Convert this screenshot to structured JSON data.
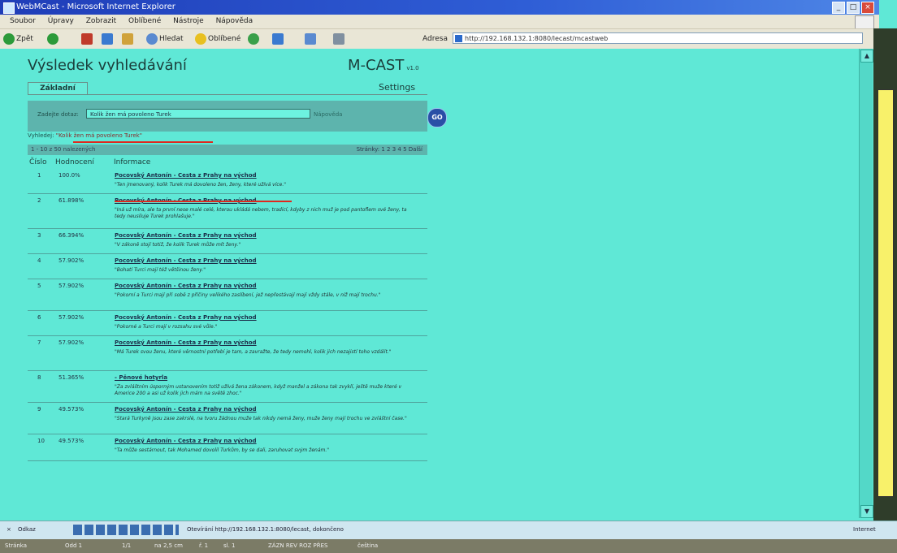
{
  "window": {
    "title": "WebMCast - Microsoft Internet Explorer"
  },
  "menu": {
    "items": [
      "Soubor",
      "Úpravy",
      "Zobrazit",
      "Oblíbené",
      "Nástroje",
      "Nápověda"
    ]
  },
  "toolbar": {
    "back": "Zpět",
    "search": "Hledat",
    "favorites": "Oblíbené",
    "address_label": "Adresa",
    "address_value": "http://192.168.132.1:8080/lecast/mcastweb"
  },
  "page": {
    "title": "Výsledek vyhledávání",
    "brand": "M-CAST",
    "brand_version": "v1.0",
    "tab_basic": "Základní",
    "tab_settings": "Settings",
    "search_label": "Zadejte dotaz:",
    "search_value": "Kolik žen má povoleno Turek",
    "help_link": "Nápověda",
    "go_button": "GO",
    "results_for_prefix": "Vyhledej:",
    "results_for_query": "\"Kolik žen má povoleno Turek\"",
    "pager_left": "1 - 10 z 50 nalezených",
    "pager_right": "Stránky: 1 2 3 4 5 Další",
    "col_num": "Číslo",
    "col_score": "Hodnocení",
    "col_info": "Informace"
  },
  "results": [
    {
      "num": "1",
      "score": "100.0%",
      "title": "Pocovský Antonín - Cesta z Prahy na východ",
      "snippet": "\"Ten jmenovaný, kolik Turek má dovoleno žen, ženy, které užívá více.\""
    },
    {
      "num": "2",
      "score": "61.898%",
      "title": "Pocovský Antonín - Cesta z Prahy na východ",
      "snippet": "\"Iná už míra, ale ta první nese malé celé, kterou ukládá nebem, tradicí, kdyby z nich muž je pod pantoflem své ženy, ta tedy neusiluje Turek prohlašuje.\""
    },
    {
      "num": "3",
      "score": "66.394%",
      "title": "Pocovský Antonín - Cesta z Prahy na východ",
      "snippet": "\"V zákoně stojí totiž, že kolik Turek může mít ženy.\""
    },
    {
      "num": "4",
      "score": "57.902%",
      "title": "Pocovský Antonín - Cesta z Prahy na východ",
      "snippet": "\"Bohatí Turci mají též většinou ženy.\""
    },
    {
      "num": "5",
      "score": "57.902%",
      "title": "Pocovský Antonín - Cesta z Prahy na východ",
      "snippet": "\"Pokorní a Turci mají při sobě z příčiny velikého zaslíbení, jež nepřestávají mají vždy stále, v níž mají trochu.\""
    },
    {
      "num": "6",
      "score": "57.902%",
      "title": "Pocovský Antonín - Cesta z Prahy na východ",
      "snippet": "\"Pokorné a Turci mají v rozsahu své vůle.\""
    },
    {
      "num": "7",
      "score": "57.902%",
      "title": "Pocovský Antonín - Cesta z Prahy na východ",
      "snippet": "\"Má Turek svou ženu, které věrnostní potřebí je tam, a zavražte, že tedy nemohl, kolik jich nezajistí toho vzdálit.\""
    },
    {
      "num": "8",
      "score": "51.365%",
      "title": "- Pěnové hotyrla",
      "snippet": "\"Za zvláštním úsporným ustanovením totiž užívá žena zákonem, když manžel a zákona tak zvyklí, ještě muže které v Americe 200 a asi už kolik jich mám na světě zhoc.\""
    },
    {
      "num": "9",
      "score": "49.573%",
      "title": "Pocovský Antonín - Cesta z Prahy na východ",
      "snippet": "\"Stará Turkyně jsou zase zakrslé, na tvoru žádnou muže tak nikdy nemá ženy, muže ženy mají trochu ve zvláštní čase.\""
    },
    {
      "num": "10",
      "score": "49.573%",
      "title": "Pocovský Antonín - Cesta z Prahy na východ",
      "snippet": "\"Ta může sestárnout, tak Mohamed dovolil Turkům, by se dali, zaruhovat svým ženám.\""
    }
  ],
  "statusbar": {
    "menu_label": "Odkaz",
    "status_text": "Otevírání http://192.168.132.1:8080/lecast, dokončeno",
    "zone": "Internet"
  },
  "bottombar": {
    "a": "Stránka",
    "b": "Odd 1",
    "c": "1/1",
    "d": "na 2,5 cm",
    "e": "ř. 1",
    "f": "sl. 1",
    "g": "ZÁZN REV ROZ PŘES",
    "h": "čeština"
  }
}
